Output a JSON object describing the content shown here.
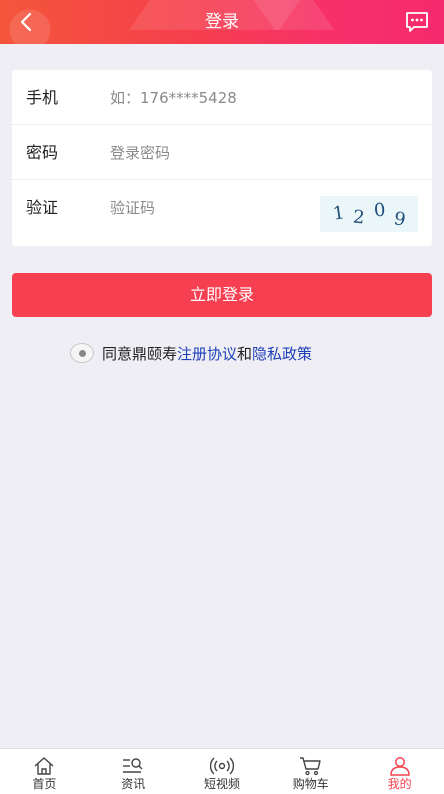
{
  "header": {
    "title": "登录",
    "back_icon": "chevron-left-icon",
    "message_icon": "message-icon",
    "gradient": [
      "#f4553a",
      "#f52a6e"
    ]
  },
  "form": {
    "phone": {
      "label": "手机",
      "placeholder": "如：176****5428",
      "value": ""
    },
    "password": {
      "label": "密码",
      "placeholder": "登录密码",
      "value": ""
    },
    "verify": {
      "label": "验证",
      "placeholder": "验证码",
      "value": "",
      "captcha": [
        "1",
        "2",
        "0",
        "9"
      ]
    }
  },
  "login_button": {
    "label": "立即登录",
    "color": "#f73f52"
  },
  "agreement": {
    "prefix": "同意鼎颐寿",
    "terms_link": "注册协议",
    "and": "和",
    "privacy_link": "隐私政策",
    "link_color": "#1d3fb8"
  },
  "tabbar": {
    "active_color": "#f3434e",
    "items": [
      {
        "label": "首页",
        "icon": "home-icon"
      },
      {
        "label": "资讯",
        "icon": "news-icon"
      },
      {
        "label": "短视频",
        "icon": "video-broadcast-icon"
      },
      {
        "label": "购物车",
        "icon": "cart-icon"
      },
      {
        "label": "我的",
        "icon": "user-icon",
        "active": true
      }
    ]
  }
}
